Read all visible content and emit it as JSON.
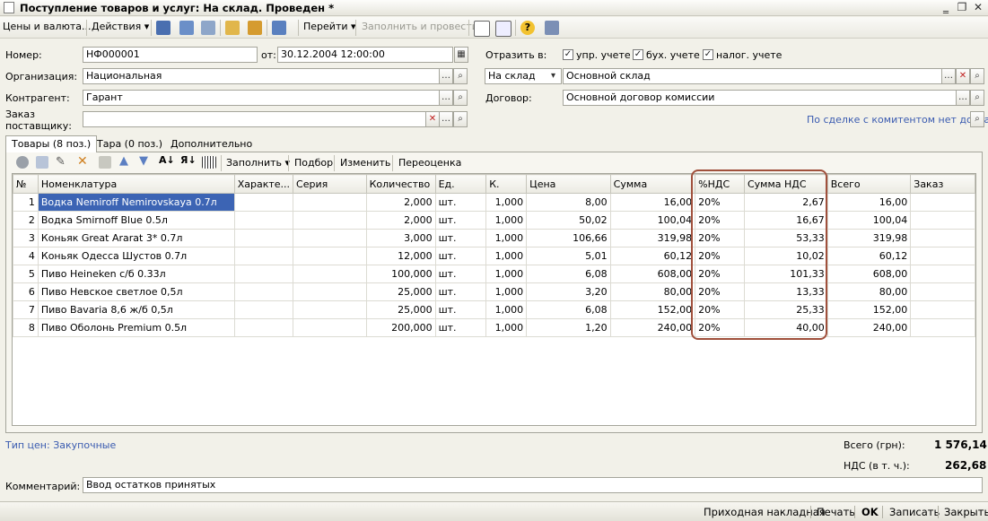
{
  "window": {
    "title": "Поступление товаров и услуг: На склад. Проведен *",
    "minimize": "‗",
    "restore": "❐",
    "close": "✕"
  },
  "toolbar": {
    "prices_currency": "Цены и валюта...",
    "actions": "Действия",
    "goto": "Перейти",
    "fill_and_post": "Заполнить и провести"
  },
  "form": {
    "number_label": "Номер:",
    "number_value": "НФ000001",
    "date_label": "от:",
    "date_value": "30.12.2004 12:00:00",
    "reflect_label": "Отразить в:",
    "reflect_mgmt": "упр. учете",
    "reflect_acc": "бух. учете",
    "reflect_tax": "налог. учете",
    "org_label": "Организация:",
    "org_value": "Национальная",
    "op_type_value": "На склад",
    "warehouse_value": "Основной склад",
    "counterparty_label": "Контрагент:",
    "counterparty_value": "Гарант",
    "contract_label": "Договор:",
    "contract_value": "Основной договор комиссии",
    "supplier_order_label_1": "Заказ",
    "supplier_order_label_2": "поставщику:",
    "supplier_order_value": "",
    "commission_debt": "По сделке с комитентом нет долга"
  },
  "tabs": [
    {
      "label": "Товары (8 поз.)"
    },
    {
      "label": "Тара (0 поз.)"
    },
    {
      "label": "Дополнительно"
    }
  ],
  "grid_toolbar": {
    "fill": "Заполнить",
    "selection": "Подбор",
    "change": "Изменить",
    "revaluation": "Переоценка"
  },
  "table": {
    "headers": [
      "№",
      "Номенклатура",
      "Характе...",
      "Серия",
      "Количество",
      "Ед.",
      "К.",
      "Цена",
      "Сумма",
      "%НДС",
      "Сумма НДС",
      "Всего",
      "Заказ"
    ],
    "rows": [
      {
        "n": "1",
        "name": "Водка Nemiroff Nemirovskaya 0.7л",
        "qty": "2,000",
        "unit": "шт.",
        "k": "1,000",
        "price": "8,00",
        "sum": "16,00",
        "vat_rate": "20%",
        "vat_sum": "2,67",
        "total": "16,00"
      },
      {
        "n": "2",
        "name": "Водка Smirnoff Blue 0.5л",
        "qty": "2,000",
        "unit": "шт.",
        "k": "1,000",
        "price": "50,02",
        "sum": "100,04",
        "vat_rate": "20%",
        "vat_sum": "16,67",
        "total": "100,04"
      },
      {
        "n": "3",
        "name": "Коньяк Great Ararat 3* 0.7л",
        "qty": "3,000",
        "unit": "шт.",
        "k": "1,000",
        "price": "106,66",
        "sum": "319,98",
        "vat_rate": "20%",
        "vat_sum": "53,33",
        "total": "319,98"
      },
      {
        "n": "4",
        "name": "Коньяк Одесса Шустов 0.7л",
        "qty": "12,000",
        "unit": "шт.",
        "k": "1,000",
        "price": "5,01",
        "sum": "60,12",
        "vat_rate": "20%",
        "vat_sum": "10,02",
        "total": "60,12"
      },
      {
        "n": "5",
        "name": "Пиво Heineken с/б 0.33л",
        "qty": "100,000",
        "unit": "шт.",
        "k": "1,000",
        "price": "6,08",
        "sum": "608,00",
        "vat_rate": "20%",
        "vat_sum": "101,33",
        "total": "608,00"
      },
      {
        "n": "6",
        "name": "Пиво Невское светлое 0,5л",
        "qty": "25,000",
        "unit": "шт.",
        "k": "1,000",
        "price": "3,20",
        "sum": "80,00",
        "vat_rate": "20%",
        "vat_sum": "13,33",
        "total": "80,00"
      },
      {
        "n": "7",
        "name": "Пиво Bavaria 8,6 ж/б 0,5л",
        "qty": "25,000",
        "unit": "шт.",
        "k": "1,000",
        "price": "6,08",
        "sum": "152,00",
        "vat_rate": "20%",
        "vat_sum": "25,33",
        "total": "152,00"
      },
      {
        "n": "8",
        "name": "Пиво Оболонь Premium 0.5л",
        "qty": "200,000",
        "unit": "шт.",
        "k": "1,000",
        "price": "1,20",
        "sum": "240,00",
        "vat_rate": "20%",
        "vat_sum": "40,00",
        "total": "240,00"
      }
    ]
  },
  "footer": {
    "price_type": "Тип цен: Закупочные",
    "total_label": "Всего (грн):",
    "total_value": "1 576,14",
    "vat_label": "НДС (в т. ч.):",
    "vat_value": "262,68",
    "comment_label": "Комментарий:",
    "comment_value": "Ввод остатков принятых"
  },
  "bottom_buttons": {
    "invoice": "Приходная накладная",
    "print": "Печать",
    "ok": "OK",
    "save": "Записать",
    "close": "Закрыть"
  }
}
